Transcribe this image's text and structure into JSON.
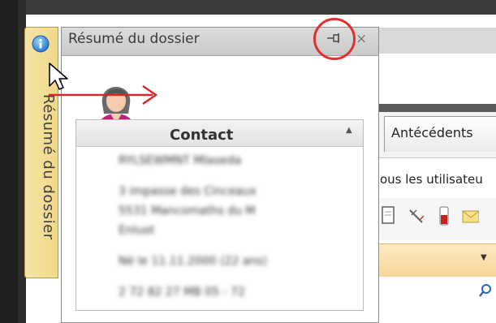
{
  "dock_tab": {
    "label": "Résumé du dossier",
    "icon": "info-icon"
  },
  "panel": {
    "title": "Résumé du dossier",
    "pin_symbol": "⊣",
    "close_symbol": "×",
    "section": {
      "title": "Contact",
      "collapse_symbol": "▲",
      "lines": [
        "RYLSEWMNT Mlaoeda",
        "3 impasse des Cinceaux",
        "5531 Mancomaths du M",
        "Enluot",
        "Né le 11.11.2000 (22 ans)",
        "2 72 82 27 MB 05 - 72"
      ]
    }
  },
  "background_app": {
    "tab_label": "Antécédents",
    "users_text": "ous les utilisateu",
    "dropdown_symbol": "▼"
  },
  "colors": {
    "annotation": "#e23030",
    "dock_tab": "#f3dc90"
  }
}
